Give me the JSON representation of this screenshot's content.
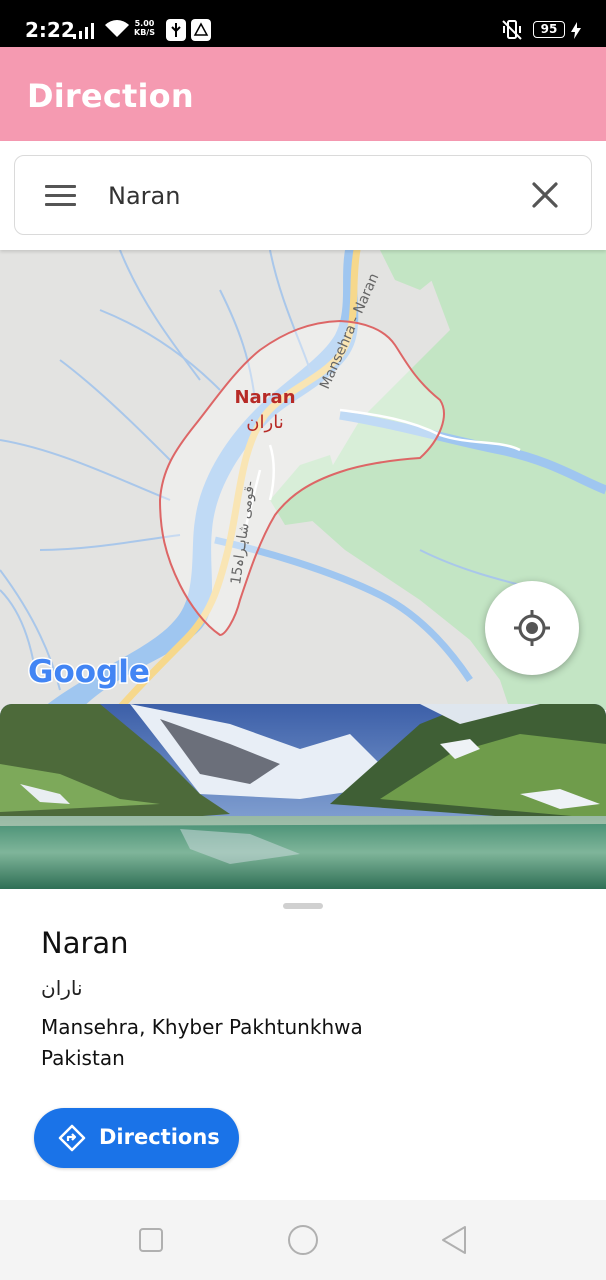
{
  "status_bar": {
    "time": "2:22",
    "net_speed_value": "5.00",
    "net_speed_unit": "KB/S",
    "battery": "95"
  },
  "app_bar": {
    "title": "Direction"
  },
  "search": {
    "value": "Naran"
  },
  "map": {
    "label_en": "Naran",
    "label_ur": "ناران",
    "road_label_1": "Mansehra - Naran",
    "road_label_2": "قومی شاہراہ15-",
    "attribution": "Google",
    "colors": {
      "land": "#e3e3e1",
      "park": "#c3e5c4",
      "water": "#9fc6f0",
      "road": "#f6d88c",
      "boundary": "#dd6666"
    }
  },
  "place": {
    "name": "Naran",
    "name_urdu": "ناران",
    "address_line1": "Mansehra, Khyber Pakhtunkhwa",
    "address_line2": "Pakistan",
    "directions_label": "Directions"
  },
  "icons": [
    "menu-icon",
    "close-icon",
    "my-location-icon",
    "directions-icon",
    "recents-icon",
    "home-icon",
    "back-icon"
  ]
}
